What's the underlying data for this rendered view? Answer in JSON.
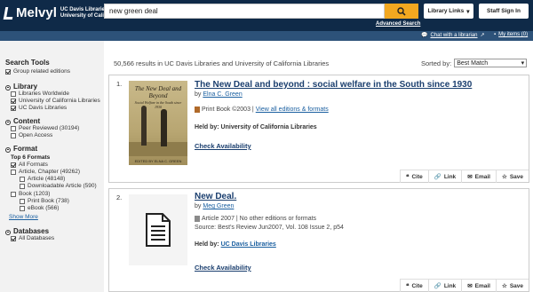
{
  "header": {
    "logo": "Melvyl",
    "logo_sub_1": "UC Davis Libraries",
    "logo_sub_2": "University of California",
    "search_value": "new green deal",
    "advanced_search": "Advanced Search",
    "library_links": "Library Links",
    "staff_sign_in": "Staff Sign In",
    "chat": "Chat with a librarian",
    "my_items": "My items (0)"
  },
  "sidebar": {
    "search_tools_title": "Search Tools",
    "group_related": "Group related editions",
    "library_title": "Library",
    "library_items": [
      "Libraries Worldwide",
      "University of California Libraries",
      "UC Davis Libraries"
    ],
    "content_title": "Content",
    "content_items": [
      "Peer Reviewed (30194)",
      "Open Access"
    ],
    "format_title": "Format",
    "top_formats": "Top 6 Formats",
    "format_items": [
      "All Formats",
      "Article, Chapter (49262)",
      "Article (48148)",
      "Downloadable Article (590)",
      "Book (1203)",
      "Print Book (738)",
      "eBook (566)"
    ],
    "show_more": "Show More",
    "databases_title": "Databases",
    "databases_items": [
      "All Databases"
    ]
  },
  "main": {
    "summary": "50,566 results in UC Davis Libraries and University of California Libraries",
    "sorted_by": "Sorted by:",
    "sort_value": "Best Match",
    "results": [
      {
        "num": "1.",
        "title": "The New Deal and beyond : social welfare in the South since 1930",
        "by": "by",
        "author": "Elna C. Green",
        "format": "Print Book ©2003 |",
        "format_link": "View all editions & formats",
        "held_label": "Held by: University of California Libraries",
        "check": "Check Availability",
        "cover_title": "The New Deal and Beyond",
        "cover_sub": "Social Welfare in the South since 1930",
        "cover_footer": "EDITED BY ELNA C. GREEN"
      },
      {
        "num": "2.",
        "title": "New Deal.",
        "by": "by",
        "author": "Meg Green",
        "format": "Article 2007 | No other editions or formats",
        "source": "Source: Best's Review Jun2007, Vol. 108 Issue 2, p54",
        "held_label": "Held by:",
        "held_lib": "UC Davis Libraries",
        "check": "Check Availability"
      }
    ],
    "actions": [
      "Cite",
      "Link",
      "Email",
      "Save"
    ]
  },
  "colors": {
    "header_bg": "#0f2a48",
    "subbar_bg": "#2d5279",
    "search_button": "#f3a820",
    "link": "#1a5fa0"
  }
}
